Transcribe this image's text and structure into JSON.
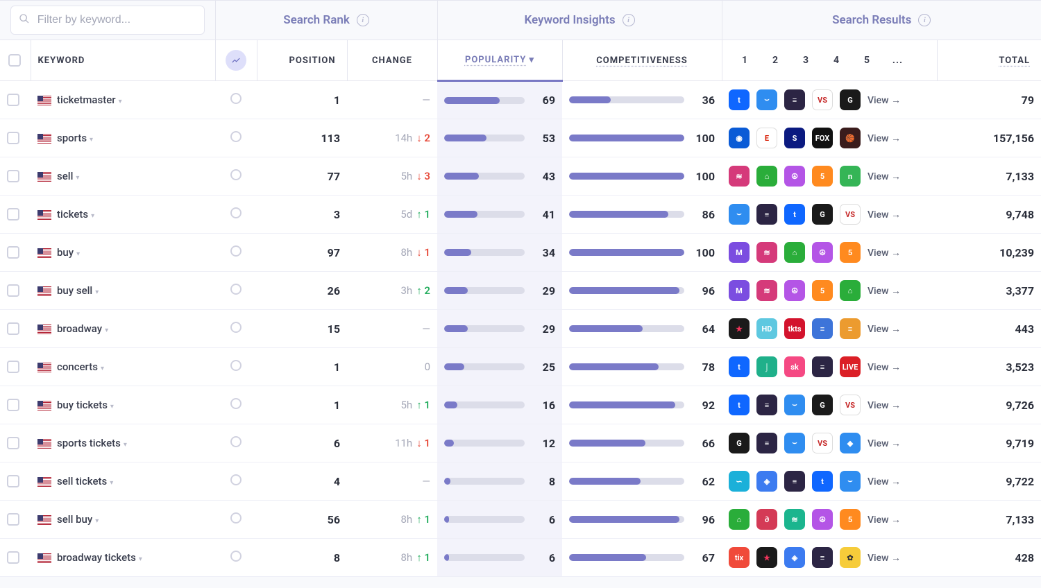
{
  "filter": {
    "placeholder": "Filter by keyword..."
  },
  "sections": {
    "search_rank": "Search Rank",
    "keyword_insights": "Keyword Insights",
    "search_results": "Search Results"
  },
  "columns": {
    "keyword": "KEYWORD",
    "position": "POSITION",
    "change": "CHANGE",
    "popularity": "POPULARITY",
    "competitiveness": "COMPETITIVENESS",
    "sr_nums": [
      "1",
      "2",
      "3",
      "4",
      "5",
      "..."
    ],
    "total": "TOTAL",
    "view_label": "View →"
  },
  "rows": [
    {
      "kw": "ticketmaster",
      "pos": "1",
      "chg_t": "",
      "chg_dir": "",
      "chg_v": "—",
      "pop": 69,
      "comp": 36,
      "apps": [
        {
          "t": "t",
          "bg": "#0f67ff"
        },
        {
          "t": "⌣",
          "bg": "#2f8df0"
        },
        {
          "t": "≡",
          "bg": "#2c2544"
        },
        {
          "t": "VS",
          "bg": "#ffffff",
          "fg": "#c62828"
        },
        {
          "t": "G",
          "bg": "#1a1a1a"
        }
      ],
      "total": "79"
    },
    {
      "kw": "sports",
      "pos": "113",
      "chg_t": "14h",
      "chg_dir": "dn",
      "chg_v": "↓ 2",
      "pop": 53,
      "comp": 100,
      "apps": [
        {
          "t": "◉",
          "bg": "#0a5bd6"
        },
        {
          "t": "E",
          "bg": "#ffffff",
          "fg": "#d81e05"
        },
        {
          "t": "S",
          "bg": "#0b1a80"
        },
        {
          "t": "FOX",
          "bg": "#111"
        },
        {
          "t": "🏀",
          "bg": "#3a1c1c"
        }
      ],
      "total": "157,156"
    },
    {
      "kw": "sell",
      "pos": "77",
      "chg_t": "5h",
      "chg_dir": "dn",
      "chg_v": "↓ 3",
      "pop": 43,
      "comp": 100,
      "apps": [
        {
          "t": "≋",
          "bg": "#d53a7a"
        },
        {
          "t": "⌂",
          "bg": "#2aad3a"
        },
        {
          "t": "☮",
          "bg": "#b455e6"
        },
        {
          "t": "5",
          "bg": "#ff8a1f"
        },
        {
          "t": "n",
          "bg": "#35b556"
        }
      ],
      "total": "7,133"
    },
    {
      "kw": "tickets",
      "pos": "3",
      "chg_t": "5d",
      "chg_dir": "up",
      "chg_v": "↑ 1",
      "pop": 41,
      "comp": 86,
      "apps": [
        {
          "t": "⌣",
          "bg": "#2f8df0"
        },
        {
          "t": "≡",
          "bg": "#2c2544"
        },
        {
          "t": "t",
          "bg": "#0f67ff"
        },
        {
          "t": "G",
          "bg": "#1a1a1a"
        },
        {
          "t": "VS",
          "bg": "#ffffff",
          "fg": "#c62828"
        }
      ],
      "total": "9,748"
    },
    {
      "kw": "buy",
      "pos": "97",
      "chg_t": "8h",
      "chg_dir": "dn",
      "chg_v": "↓ 1",
      "pop": 34,
      "comp": 100,
      "apps": [
        {
          "t": "M",
          "bg": "#7b4de0"
        },
        {
          "t": "≋",
          "bg": "#d53a7a"
        },
        {
          "t": "⌂",
          "bg": "#2aad3a"
        },
        {
          "t": "☮",
          "bg": "#b455e6"
        },
        {
          "t": "5",
          "bg": "#ff8a1f"
        }
      ],
      "total": "10,239"
    },
    {
      "kw": "buy sell",
      "pos": "26",
      "chg_t": "3h",
      "chg_dir": "up",
      "chg_v": "↑ 2",
      "pop": 29,
      "comp": 96,
      "apps": [
        {
          "t": "M",
          "bg": "#7b4de0"
        },
        {
          "t": "≋",
          "bg": "#d53a7a"
        },
        {
          "t": "☮",
          "bg": "#b455e6"
        },
        {
          "t": "5",
          "bg": "#ff8a1f"
        },
        {
          "t": "⌂",
          "bg": "#2aad3a"
        }
      ],
      "total": "3,377"
    },
    {
      "kw": "broadway",
      "pos": "15",
      "chg_t": "",
      "chg_dir": "",
      "chg_v": "—",
      "pop": 29,
      "comp": 64,
      "apps": [
        {
          "t": "★",
          "bg": "#1a1a1a",
          "fg": "#f0355b"
        },
        {
          "t": "HD",
          "bg": "#5ec8e0"
        },
        {
          "t": "tkts",
          "bg": "#d3132d"
        },
        {
          "t": "≡",
          "bg": "#3d74d9"
        },
        {
          "t": "≡",
          "bg": "#ec9b2f"
        }
      ],
      "total": "443"
    },
    {
      "kw": "concerts",
      "pos": "1",
      "chg_t": "",
      "chg_dir": "",
      "chg_v": "0",
      "pop": 25,
      "comp": 78,
      "apps": [
        {
          "t": "t",
          "bg": "#0f67ff"
        },
        {
          "t": "⌡",
          "bg": "#1fb08a"
        },
        {
          "t": "sk",
          "bg": "#f54983"
        },
        {
          "t": "≡",
          "bg": "#2c2544"
        },
        {
          "t": "LIVE",
          "bg": "#db1f26"
        }
      ],
      "total": "3,523"
    },
    {
      "kw": "buy tickets",
      "pos": "1",
      "chg_t": "5h",
      "chg_dir": "up",
      "chg_v": "↑ 1",
      "pop": 16,
      "comp": 92,
      "apps": [
        {
          "t": "t",
          "bg": "#0f67ff"
        },
        {
          "t": "≡",
          "bg": "#2c2544"
        },
        {
          "t": "⌣",
          "bg": "#2f8df0"
        },
        {
          "t": "G",
          "bg": "#1a1a1a"
        },
        {
          "t": "VS",
          "bg": "#ffffff",
          "fg": "#c62828"
        }
      ],
      "total": "9,726"
    },
    {
      "kw": "sports tickets",
      "pos": "6",
      "chg_t": "11h",
      "chg_dir": "dn",
      "chg_v": "↓ 1",
      "pop": 12,
      "comp": 66,
      "apps": [
        {
          "t": "G",
          "bg": "#1a1a1a"
        },
        {
          "t": "≡",
          "bg": "#2c2544"
        },
        {
          "t": "⌣",
          "bg": "#2f8df0"
        },
        {
          "t": "VS",
          "bg": "#ffffff",
          "fg": "#c62828"
        },
        {
          "t": "◆",
          "bg": "#2f8df0"
        }
      ],
      "total": "9,719"
    },
    {
      "kw": "sell tickets",
      "pos": "4",
      "chg_t": "",
      "chg_dir": "",
      "chg_v": "—",
      "pop": 8,
      "comp": 62,
      "apps": [
        {
          "t": "∽",
          "bg": "#1bb0d9"
        },
        {
          "t": "◈",
          "bg": "#3c7bf0"
        },
        {
          "t": "≡",
          "bg": "#2c2544"
        },
        {
          "t": "t",
          "bg": "#0f67ff"
        },
        {
          "t": "⌣",
          "bg": "#2f8df0"
        }
      ],
      "total": "9,722"
    },
    {
      "kw": "sell buy",
      "pos": "56",
      "chg_t": "8h",
      "chg_dir": "up",
      "chg_v": "↑ 1",
      "pop": 6,
      "comp": 96,
      "apps": [
        {
          "t": "⌂",
          "bg": "#2aad3a"
        },
        {
          "t": "∂",
          "bg": "#d43a56"
        },
        {
          "t": "≋",
          "bg": "#1bb58e"
        },
        {
          "t": "☮",
          "bg": "#b455e6"
        },
        {
          "t": "5",
          "bg": "#ff8a1f"
        }
      ],
      "total": "7,133"
    },
    {
      "kw": "broadway tickets",
      "pos": "8",
      "chg_t": "8h",
      "chg_dir": "up",
      "chg_v": "↑ 1",
      "pop": 6,
      "comp": 67,
      "apps": [
        {
          "t": "tix",
          "bg": "#f04a3a"
        },
        {
          "t": "★",
          "bg": "#1a1a1a",
          "fg": "#f0355b"
        },
        {
          "t": "◈",
          "bg": "#3c7bf0"
        },
        {
          "t": "≡",
          "bg": "#2c2544"
        },
        {
          "t": "✿",
          "bg": "#f6cc3a",
          "fg": "#333"
        }
      ],
      "total": "428"
    }
  ]
}
